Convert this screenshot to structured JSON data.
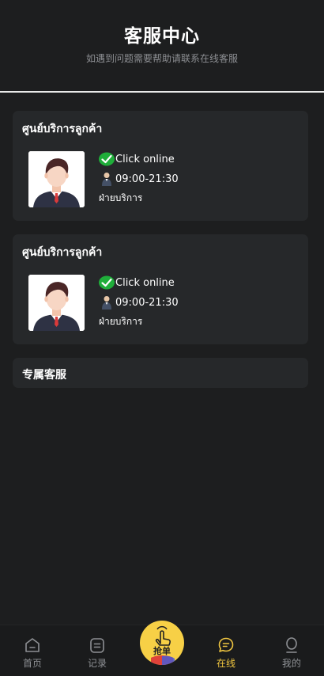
{
  "header": {
    "title": "客服中心",
    "subtitle": "如遇到问题需要帮助请联系在线客服"
  },
  "cards": [
    {
      "title": "ศูนย์บริการลูกค้า",
      "status": "Click online",
      "hours": "09:00-21:30",
      "department": "ฝ่ายบริการ"
    },
    {
      "title": "ศูนย์บริการลูกค้า",
      "status": "Click online",
      "hours": "09:00-21:30",
      "department": "ฝ่ายบริการ"
    }
  ],
  "exclusive_section": {
    "title": "专属客服"
  },
  "tabbar": {
    "items": [
      {
        "label": "首页",
        "icon": "home-icon"
      },
      {
        "label": "记录",
        "icon": "record-icon"
      },
      {
        "label": "抢单",
        "icon": "tap-hand-icon"
      },
      {
        "label": "在线",
        "icon": "chat-icon",
        "active": true
      },
      {
        "label": "我的",
        "icon": "user-icon"
      }
    ],
    "active_color": "#f0c640",
    "center_button_color": "#f7d046"
  }
}
